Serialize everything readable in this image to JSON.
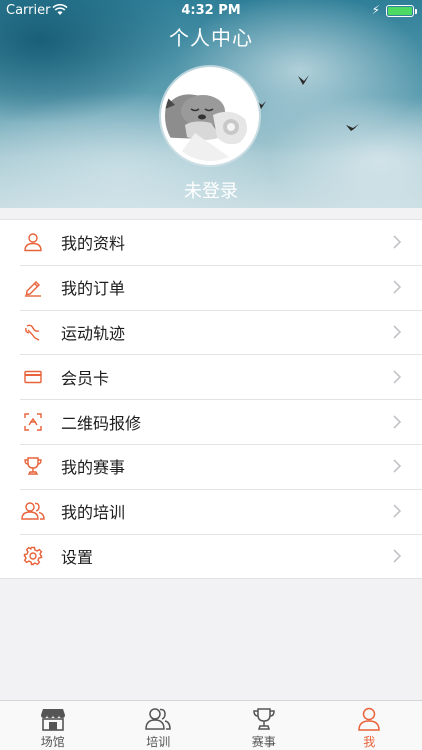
{
  "status_bar": {
    "carrier": "Carrier",
    "time": "4:32 PM"
  },
  "header": {
    "title": "个人中心",
    "login_status": "未登录"
  },
  "menu": {
    "items": [
      {
        "label": "我的资料",
        "icon": "user-icon"
      },
      {
        "label": "我的订单",
        "icon": "edit-icon"
      },
      {
        "label": "运动轨迹",
        "icon": "track-icon"
      },
      {
        "label": "会员卡",
        "icon": "card-icon"
      },
      {
        "label": "二维码报修",
        "icon": "qr-scan-icon"
      },
      {
        "label": "我的赛事",
        "icon": "trophy-icon"
      },
      {
        "label": "我的培训",
        "icon": "group-icon"
      },
      {
        "label": "设置",
        "icon": "gear-icon"
      }
    ]
  },
  "tabbar": {
    "tabs": [
      {
        "label": "场馆",
        "icon": "store-icon",
        "active": false
      },
      {
        "label": "培训",
        "icon": "group-icon",
        "active": false
      },
      {
        "label": "赛事",
        "icon": "trophy-icon",
        "active": false
      },
      {
        "label": "我",
        "icon": "person-icon",
        "active": true
      }
    ]
  },
  "colors": {
    "accent": "#e8623a",
    "background": "#f2f2f4",
    "header_teal": "#2f7f98"
  }
}
